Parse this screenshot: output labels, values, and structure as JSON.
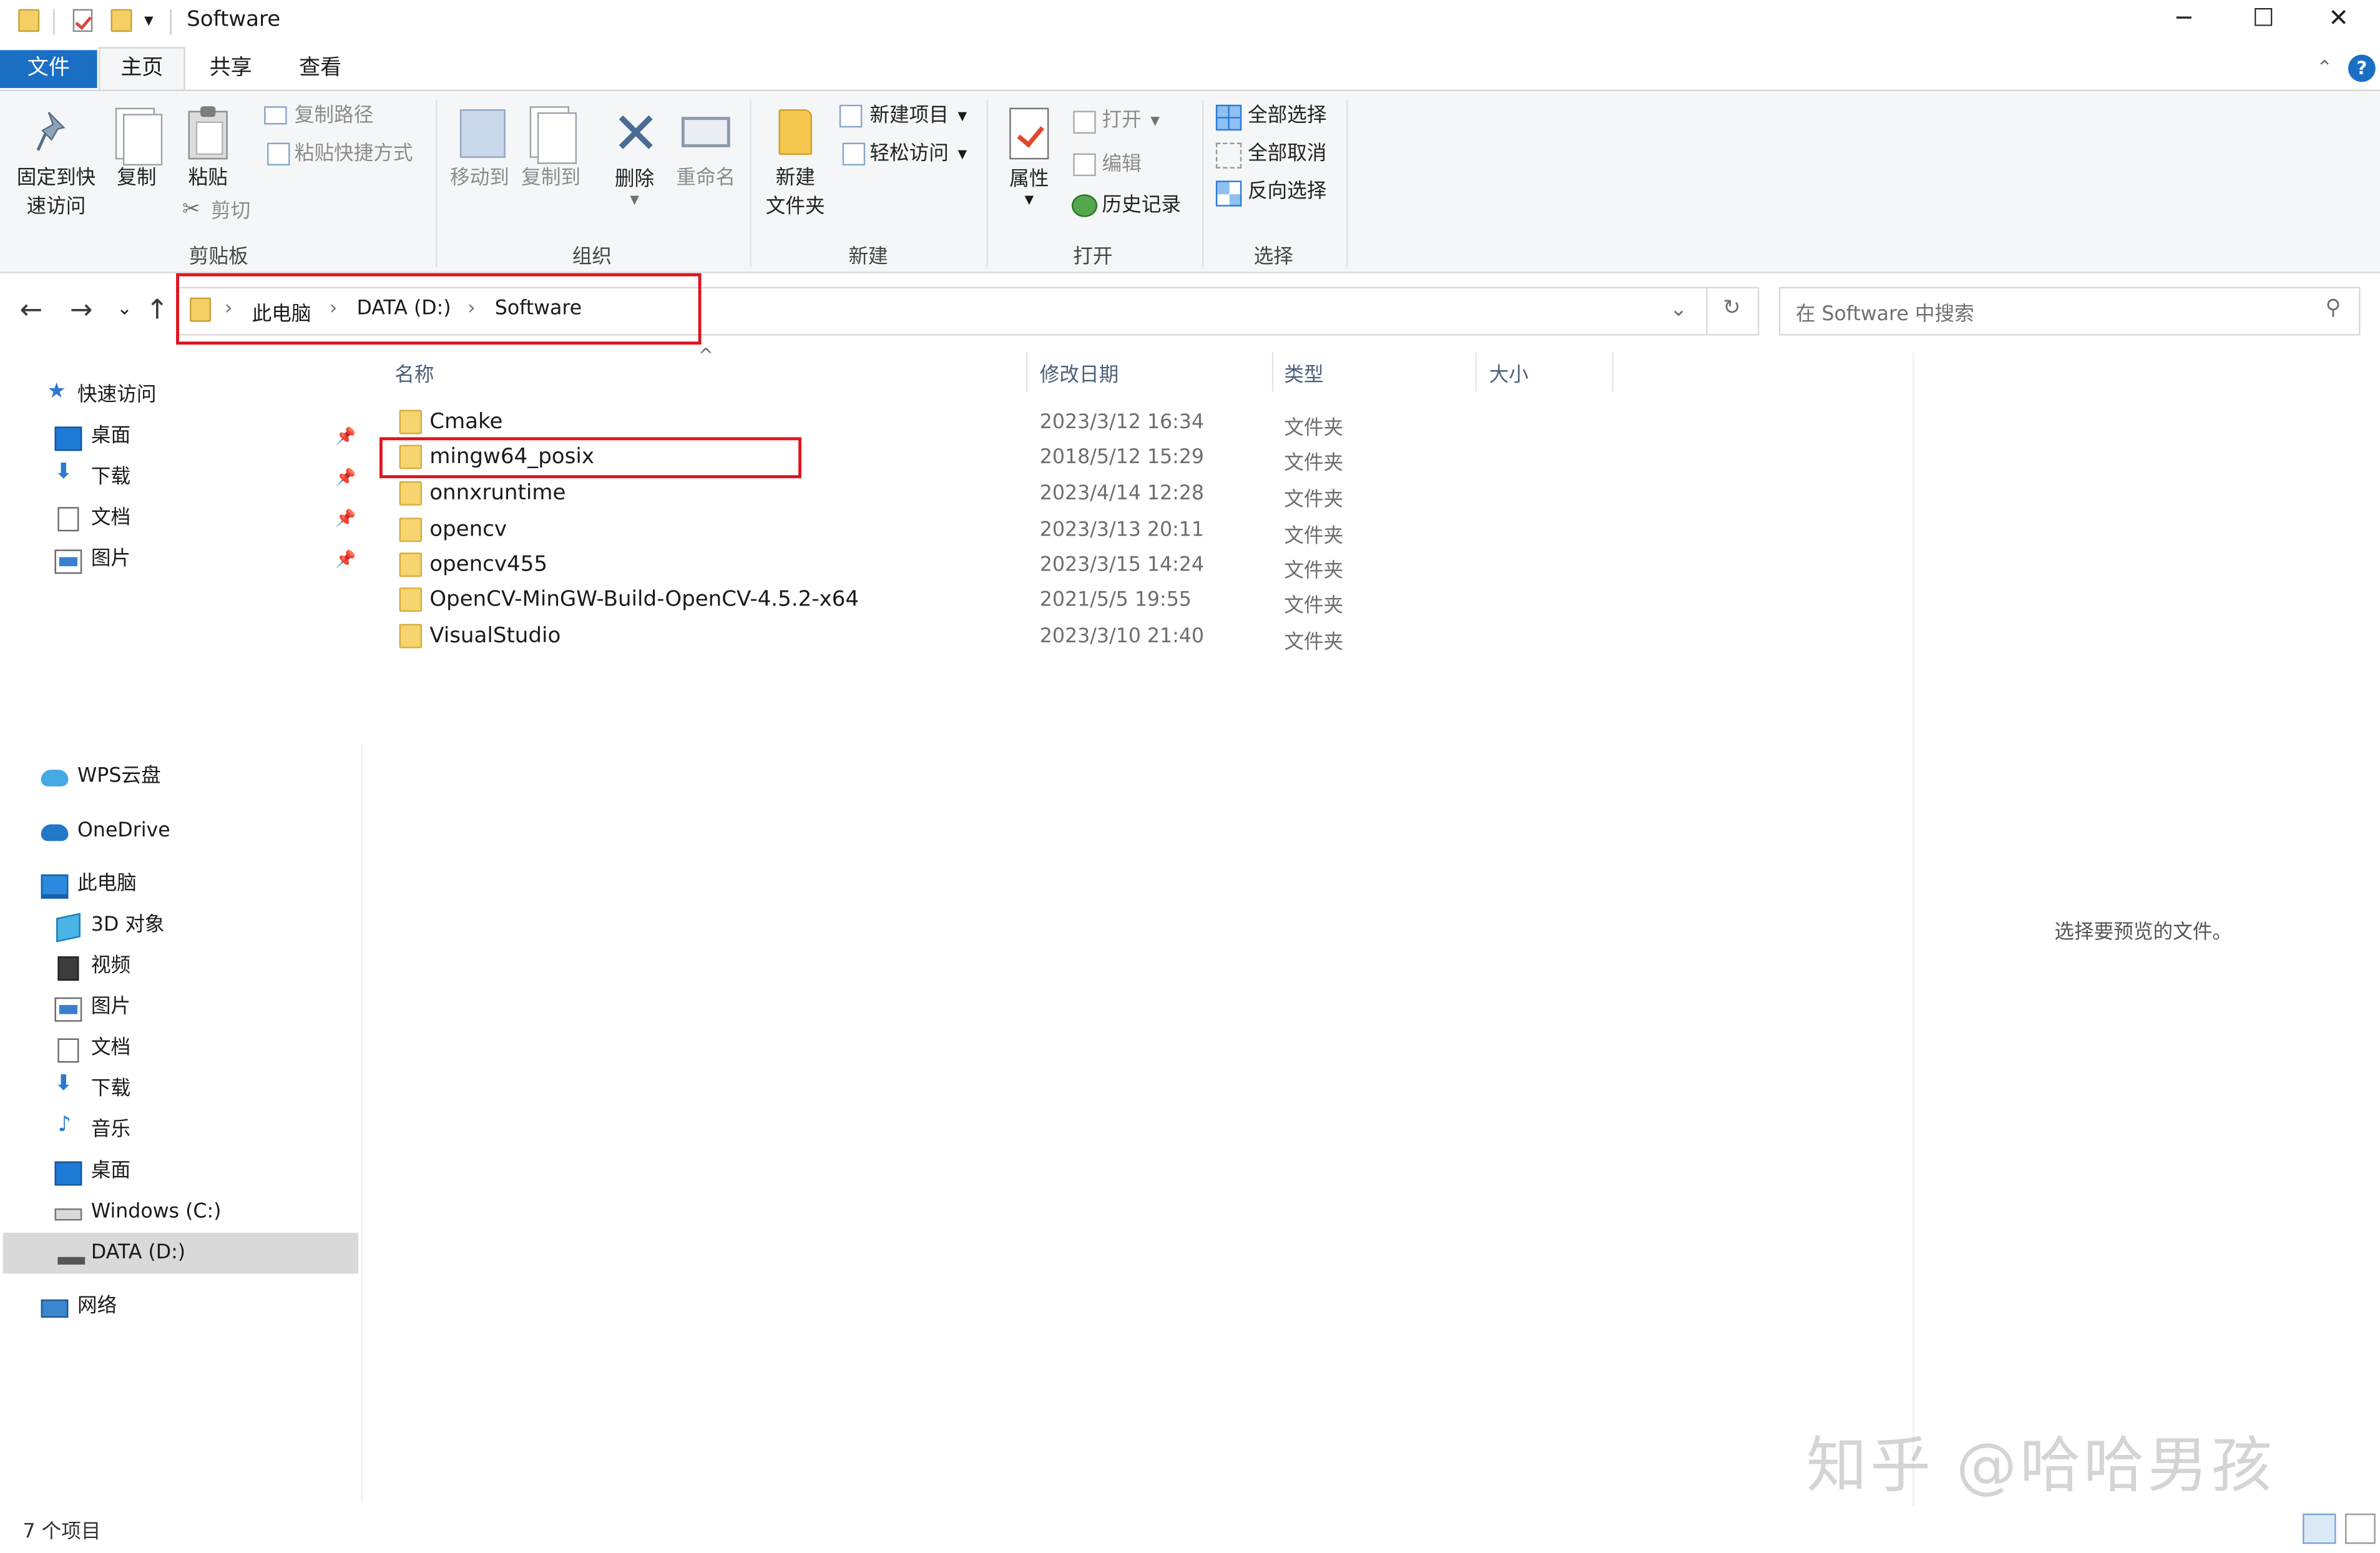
{
  "window": {
    "title": "Software",
    "controls": {
      "minimize": "─",
      "maximize": "☐",
      "close": "✕"
    }
  },
  "quick_access_toolbar": {
    "dropdown": "▾"
  },
  "ribbon": {
    "tabs": {
      "file": "文件",
      "home": "主页",
      "share": "共享",
      "view": "查看"
    },
    "collapse_glyph": "⌃",
    "help_glyph": "?",
    "clipboard": {
      "label": "剪贴板",
      "pin": "固定到快\n速访问",
      "copy": "复制",
      "paste": "粘贴",
      "copy_path": "复制路径",
      "paste_shortcut": "粘贴快捷方式",
      "cut": "剪切"
    },
    "organize": {
      "label": "组织",
      "move_to": "移动到",
      "copy_to": "复制到",
      "delete": "删除",
      "rename": "重命名"
    },
    "new": {
      "label": "新建",
      "new_folder": "新建\n文件夹",
      "new_item": "新建项目",
      "easy_access": "轻松访问"
    },
    "open": {
      "label": "打开",
      "properties": "属性",
      "open": "打开",
      "edit": "编辑",
      "history": "历史记录"
    },
    "select": {
      "label": "选择",
      "select_all": "全部选择",
      "select_none": "全部取消",
      "invert": "反向选择"
    }
  },
  "address_bar": {
    "back": "←",
    "forward": "→",
    "recent": "⌄",
    "up": "↑",
    "breadcrumb": [
      "此电脑",
      "DATA (D:)",
      "Software"
    ],
    "separator": "›",
    "dropdown": "⌄",
    "refresh": "↻",
    "search_placeholder": "在 Software 中搜索",
    "search_icon": "⚲"
  },
  "nav_pane": {
    "quick_access": "快速访问",
    "quick_items": [
      "桌面",
      "下载",
      "文档",
      "图片"
    ],
    "wps": "WPS云盘",
    "onedrive": "OneDrive",
    "this_pc": "此电脑",
    "pc_items": [
      "3D 对象",
      "视频",
      "图片",
      "文档",
      "下载",
      "音乐",
      "桌面",
      "Windows (C:)",
      "DATA (D:)"
    ],
    "network": "网络"
  },
  "file_list": {
    "columns": {
      "name": "名称",
      "modified": "修改日期",
      "type": "类型",
      "size": "大小"
    },
    "sort_glyph": "^",
    "rows": [
      {
        "name": "Cmake",
        "modified": "2023/3/12 16:34",
        "type": "文件夹"
      },
      {
        "name": "mingw64_posix",
        "modified": "2018/5/12 15:29",
        "type": "文件夹"
      },
      {
        "name": "onnxruntime",
        "modified": "2023/4/14 12:28",
        "type": "文件夹"
      },
      {
        "name": "opencv",
        "modified": "2023/3/13 20:11",
        "type": "文件夹"
      },
      {
        "name": "opencv455",
        "modified": "2023/3/15 14:24",
        "type": "文件夹"
      },
      {
        "name": "OpenCV-MinGW-Build-OpenCV-4.5.2-x64",
        "modified": "2021/5/5 19:55",
        "type": "文件夹"
      },
      {
        "name": "VisualStudio",
        "modified": "2023/3/10 21:40",
        "type": "文件夹"
      }
    ]
  },
  "preview_pane": {
    "message": "选择要预览的文件。"
  },
  "status_bar": {
    "item_count": "7 个项目"
  },
  "watermark": "知乎 @哈哈男孩",
  "colors": {
    "accent": "#1a6fc5",
    "highlight": "#e0141e",
    "folder": "#f6d470"
  }
}
